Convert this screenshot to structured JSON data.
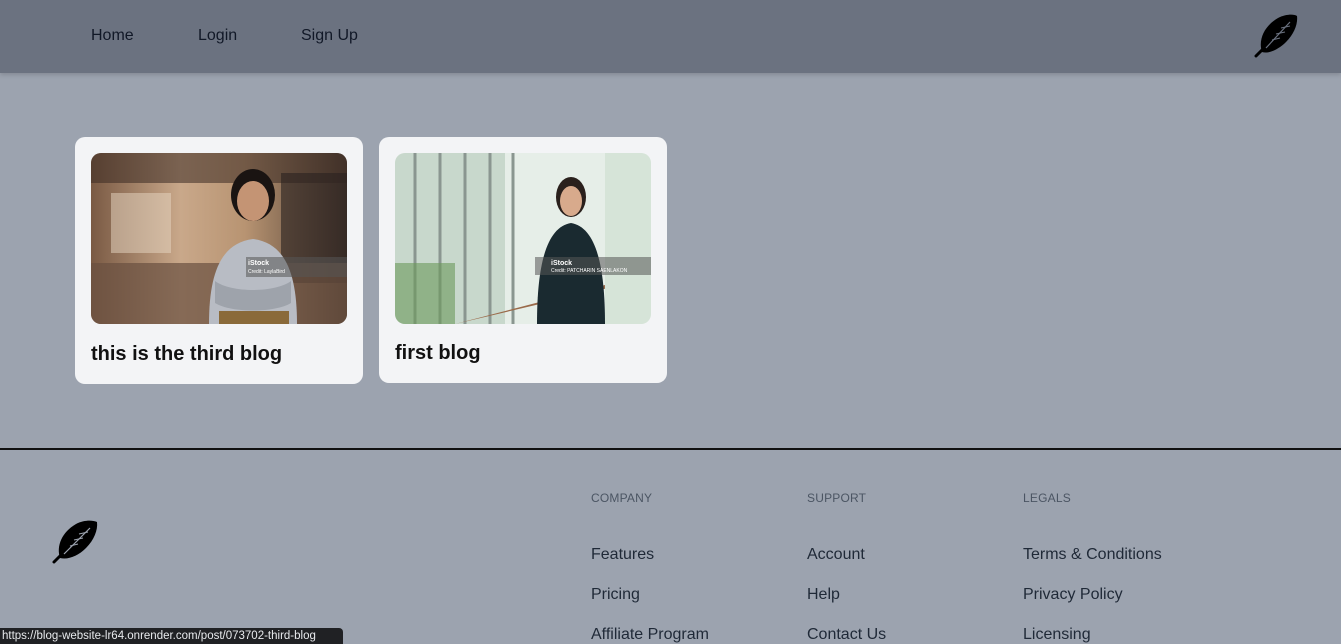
{
  "nav": {
    "links": [
      "Home",
      "Login",
      "Sign Up"
    ],
    "logo_icon": "feather-icon"
  },
  "cards": [
    {
      "title": "this is the third blog",
      "watermark_brand": "iStock",
      "watermark_credit": "Credit: LaylaBird"
    },
    {
      "title": "first blog",
      "watermark_brand": "iStock",
      "watermark_credit": "Credit: PATCHARIN SAENLAKON"
    }
  ],
  "footer": {
    "logo_icon": "feather-icon",
    "columns": [
      {
        "heading": "COMPANY",
        "links": [
          "Features",
          "Pricing",
          "Affiliate Program"
        ]
      },
      {
        "heading": "SUPPORT",
        "links": [
          "Account",
          "Help",
          "Contact Us"
        ]
      },
      {
        "heading": "LEGALS",
        "links": [
          "Terms & Conditions",
          "Privacy Policy",
          "Licensing"
        ]
      }
    ]
  },
  "status_url": "https://blog-website-lr64.onrender.com/post/073702-third-blog",
  "colors": {
    "navbar": "#6b7280",
    "background": "#9ca3af",
    "card": "#f3f4f6"
  }
}
